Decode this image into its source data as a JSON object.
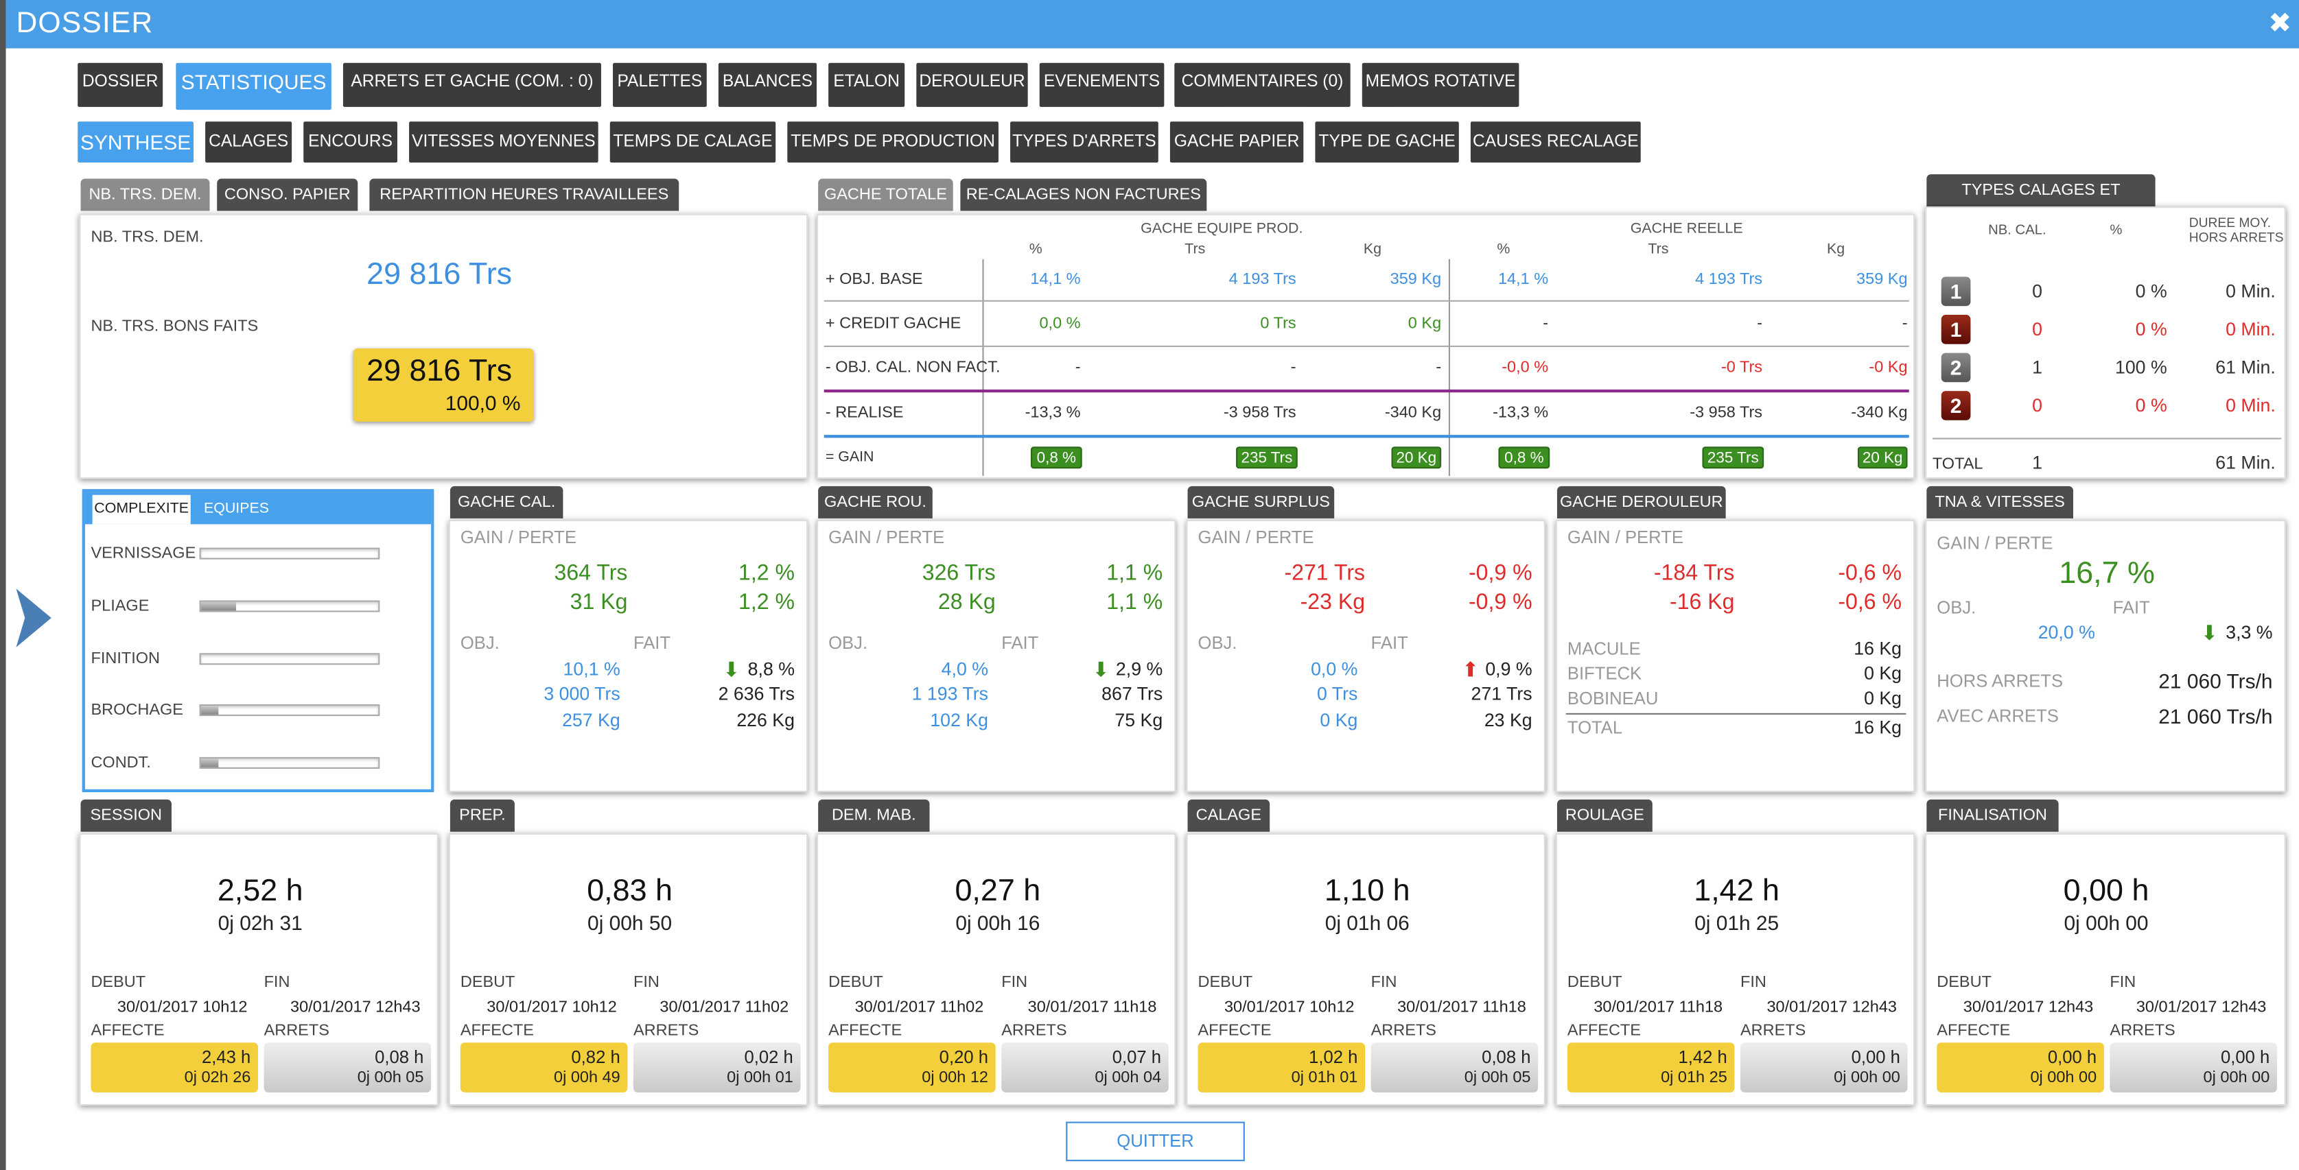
{
  "window": {
    "title": "DOSSIER",
    "close": "✖"
  },
  "main_tabs": [
    "DOSSIER",
    "STATISTIQUES",
    "ARRETS ET GACHE (COM. : 0)",
    "PALETTES",
    "BALANCES",
    "ETALON",
    "DEROULEUR",
    "EVENEMENTS",
    "COMMENTAIRES (0)",
    "MEMOS ROTATIVE"
  ],
  "sub_tabs": [
    "SYNTHESE",
    "CALAGES",
    "ENCOURS",
    "VITESSES MOYENNES",
    "TEMPS DE CALAGE",
    "TEMPS DE PRODUCTION",
    "TYPES D'ARRETS",
    "GACHE PAPIER",
    "TYPE DE GACHE",
    "CAUSES RECALAGE"
  ],
  "p1": {
    "tabs": [
      "NB. TRS. DEM.",
      "CONSO. PAPIER",
      "REPARTITION HEURES TRAVAILLEES"
    ],
    "dem_label": "NB. TRS. DEM.",
    "dem_value": "29 816 Trs",
    "bons_label": "NB. TRS. BONS FAITS",
    "bons_value": "29 816 Trs",
    "bons_pct": "100,0 %"
  },
  "p2": {
    "tabs": [
      "GACHE TOTALE",
      "RE-CALAGES NON FACTURES"
    ],
    "group1": "GACHE EQUIPE PROD.",
    "group2": "GACHE REELLE",
    "cols": [
      "%",
      "Trs",
      "Kg",
      "%",
      "Trs",
      "Kg"
    ],
    "rows": [
      {
        "label": "+ OBJ. BASE",
        "v": [
          "14,1 %",
          "4 193 Trs",
          "359 Kg",
          "14,1 %",
          "4 193 Trs",
          "359 Kg"
        ]
      },
      {
        "label": "+ CREDIT GACHE",
        "v": [
          "0,0 %",
          "0 Trs",
          "0 Kg",
          "-",
          "-",
          "-"
        ]
      },
      {
        "label": "- OBJ. CAL. NON FACT.",
        "v": [
          "-",
          "-",
          "-",
          "-0,0 %",
          "-0 Trs",
          "-0 Kg"
        ]
      },
      {
        "label": "- REALISE",
        "v": [
          "-13,3 %",
          "-3 958 Trs",
          "-340 Kg",
          "-13,3 %",
          "-3 958 Trs",
          "-340 Kg"
        ]
      },
      {
        "label": "= GAIN",
        "v": [
          "0,8 %",
          "235 Trs",
          "20 Kg",
          "0,8 %",
          "235 Trs",
          "20 Kg"
        ]
      }
    ]
  },
  "p3": {
    "tab": "TYPES CALAGES ET DUREES",
    "cols": [
      "NB. CAL.",
      "%",
      "DUREE MOY.",
      "HORS ARRETS"
    ],
    "rows": [
      {
        "icon": "1",
        "nb": "0",
        "pct": "0 %",
        "dur": "0 Min."
      },
      {
        "icon": "1",
        "nb": "0",
        "pct": "0 %",
        "dur": "0 Min."
      },
      {
        "icon": "2",
        "nb": "1",
        "pct": "100 %",
        "dur": "61 Min."
      },
      {
        "icon": "2",
        "nb": "0",
        "pct": "0 %",
        "dur": "0 Min."
      }
    ],
    "total_label": "TOTAL",
    "total_nb": "1",
    "total_dur": "61 Min."
  },
  "complexite": {
    "tabs": [
      "COMPLEXITE",
      "EQUIPES"
    ],
    "items": [
      {
        "label": "VERNISSAGE",
        "fill": 0
      },
      {
        "label": "PLIAGE",
        "fill": 0.2
      },
      {
        "label": "FINITION",
        "fill": 0
      },
      {
        "label": "BROCHAGE",
        "fill": 0.1
      },
      {
        "label": "CONDT.",
        "fill": 0.1
      }
    ]
  },
  "gache_cal": {
    "tab": "GACHE CAL.",
    "gp": "GAIN / PERTE",
    "v1": "364 Trs",
    "p1": "1,2 %",
    "v2": "31 Kg",
    "p2": "1,2 %",
    "obj": "OBJ.",
    "fait": "FAIT",
    "o": [
      "10,1 %",
      "3 000 Trs",
      "257 Kg"
    ],
    "f": [
      "8,8 %",
      "2 636 Trs",
      "226 Kg"
    ]
  },
  "gache_rou": {
    "tab": "GACHE ROU.",
    "gp": "GAIN / PERTE",
    "v1": "326 Trs",
    "p1": "1,1 %",
    "v2": "28 Kg",
    "p2": "1,1 %",
    "obj": "OBJ.",
    "fait": "FAIT",
    "o": [
      "4,0 %",
      "1 193 Trs",
      "102 Kg"
    ],
    "f": [
      "2,9 %",
      "867 Trs",
      "75 Kg"
    ]
  },
  "gache_surplus": {
    "tab": "GACHE SURPLUS",
    "gp": "GAIN / PERTE",
    "v1": "-271 Trs",
    "p1": "-0,9 %",
    "v2": "-23 Kg",
    "p2": "-0,9 %",
    "obj": "OBJ.",
    "fait": "FAIT",
    "o": [
      "0,0 %",
      "0 Trs",
      "0 Kg"
    ],
    "f": [
      "0,9 %",
      "271 Trs",
      "23 Kg"
    ]
  },
  "gache_der": {
    "tab": "GACHE DEROULEUR",
    "gp": "GAIN / PERTE",
    "v1": "-184 Trs",
    "p1": "-0,6 %",
    "v2": "-16 Kg",
    "p2": "-0,6 %",
    "items": [
      {
        "l": "MACULE",
        "v": "16 Kg"
      },
      {
        "l": "BIFTECK",
        "v": "0 Kg"
      },
      {
        "l": "BOBINEAU",
        "v": "0 Kg"
      }
    ],
    "total_l": "TOTAL",
    "total_v": "16 Kg"
  },
  "tna": {
    "tab": "TNA & VITESSES",
    "gp": "GAIN / PERTE",
    "pct": "16,7 %",
    "obj": "OBJ.",
    "fait": "FAIT",
    "obj_v": "20,0 %",
    "fait_v": "3,3 %",
    "hors_l": "HORS ARRETS",
    "hors_v": "21 060 Trs/h",
    "avec_l": "AVEC ARRETS",
    "avec_v": "21 060 Trs/h"
  },
  "times": [
    {
      "tab": "SESSION",
      "h": "2,52 h",
      "d": "0j 02h 31",
      "debut": "30/01/2017 10h12",
      "fin": "30/01/2017 12h43",
      "aff_h": "2,43 h",
      "aff_d": "0j 02h 26",
      "arr_h": "0,08 h",
      "arr_d": "0j 00h 05"
    },
    {
      "tab": "PREP.",
      "h": "0,83 h",
      "d": "0j 00h 50",
      "debut": "30/01/2017 10h12",
      "fin": "30/01/2017 11h02",
      "aff_h": "0,82 h",
      "aff_d": "0j 00h 49",
      "arr_h": "0,02 h",
      "arr_d": "0j 00h 01"
    },
    {
      "tab": "DEM. MAB.",
      "h": "0,27 h",
      "d": "0j 00h 16",
      "debut": "30/01/2017 11h02",
      "fin": "30/01/2017 11h18",
      "aff_h": "0,20 h",
      "aff_d": "0j 00h 12",
      "arr_h": "0,07 h",
      "arr_d": "0j 00h 04"
    },
    {
      "tab": "CALAGE",
      "h": "1,10 h",
      "d": "0j 01h 06",
      "debut": "30/01/2017 10h12",
      "fin": "30/01/2017 11h18",
      "aff_h": "1,02 h",
      "aff_d": "0j 01h 01",
      "arr_h": "0,08 h",
      "arr_d": "0j 00h 05"
    },
    {
      "tab": "ROULAGE",
      "h": "1,42 h",
      "d": "0j 01h 25",
      "debut": "30/01/2017 11h18",
      "fin": "30/01/2017 12h43",
      "aff_h": "1,42 h",
      "aff_d": "0j 01h 25",
      "arr_h": "0,00 h",
      "arr_d": "0j 00h 00"
    },
    {
      "tab": "FINALISATION",
      "h": "0,00 h",
      "d": "0j 00h 00",
      "debut": "30/01/2017 12h43",
      "fin": "30/01/2017 12h43",
      "aff_h": "0,00 h",
      "aff_d": "0j 00h 00",
      "arr_h": "0,00 h",
      "arr_d": "0j 00h 00"
    }
  ],
  "time_labels": {
    "debut": "DEBUT",
    "fin": "FIN",
    "affecte": "AFFECTE",
    "arrets": "ARRETS"
  },
  "quit": "QUITTER",
  "colors": {
    "title": "#4a9ee6",
    "tab": "#3b3b3b",
    "green": "#3b8f21",
    "red": "#e02b2b",
    "blue": "#3d8fe0",
    "yellow": "#f3cf3b"
  }
}
